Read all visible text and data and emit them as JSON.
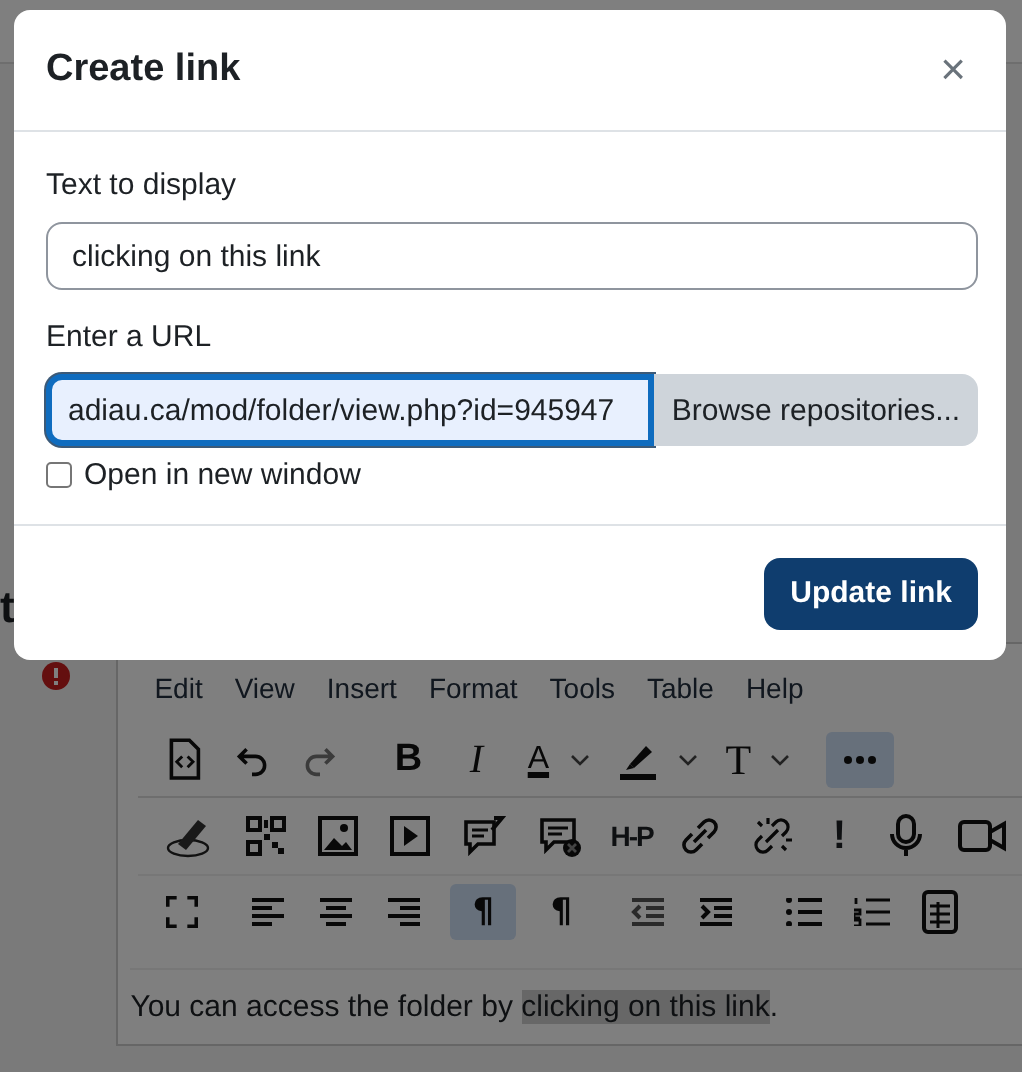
{
  "heading_fragment": "t",
  "editor": {
    "menu": [
      "Edit",
      "View",
      "Insert",
      "Format",
      "Tools",
      "Table",
      "Help"
    ],
    "toolbar": {
      "bold": "B",
      "italic": "I",
      "font_color": "A",
      "font_size": "T",
      "more_active": true,
      "h5p": "H-P",
      "alert": "!",
      "ltr": "¶",
      "ltr_active": true,
      "rtl": "¶",
      "rtl_active": false
    },
    "content": {
      "before": "You can access the folder by ",
      "highlight": "clicking on this link",
      "after": "."
    }
  },
  "dialog": {
    "title": "Create link",
    "close": "×",
    "text_label": "Text to display",
    "text_value": "clicking on this link",
    "url_label": "Enter a URL",
    "url_value": "adiau.ca/mod/folder/view.php?id=945947",
    "browse_button": "Browse repositories...",
    "new_window": {
      "label": "Open in new window",
      "checked": false
    },
    "submit": "Update link"
  }
}
